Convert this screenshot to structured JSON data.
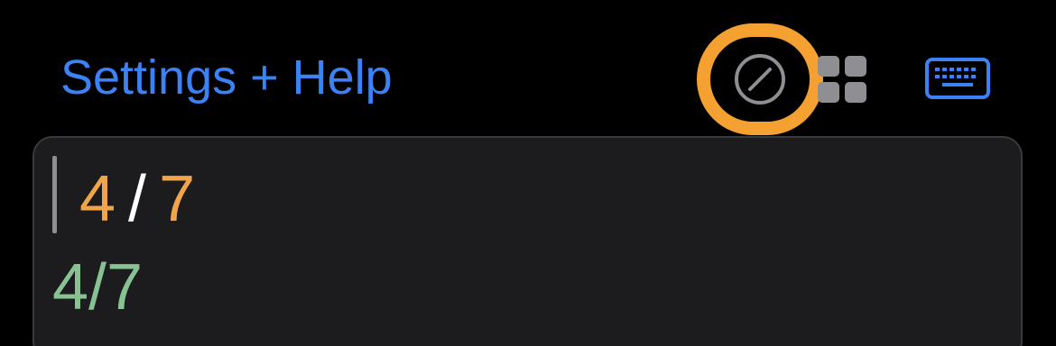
{
  "header": {
    "settings_label": "Settings + Help",
    "icons": {
      "slash": "slash-circle-icon",
      "grid": "grid-icon",
      "keyboard": "keyboard-icon"
    }
  },
  "calculator": {
    "expression": {
      "left": "4",
      "operator": "/",
      "right": "7"
    },
    "result": "4/7"
  },
  "colors": {
    "accent_blue": "#3b82f6",
    "highlight_orange": "#f5a132",
    "number_orange": "#f0a54a",
    "result_green": "#88c293",
    "panel_bg": "#1c1c1e"
  }
}
